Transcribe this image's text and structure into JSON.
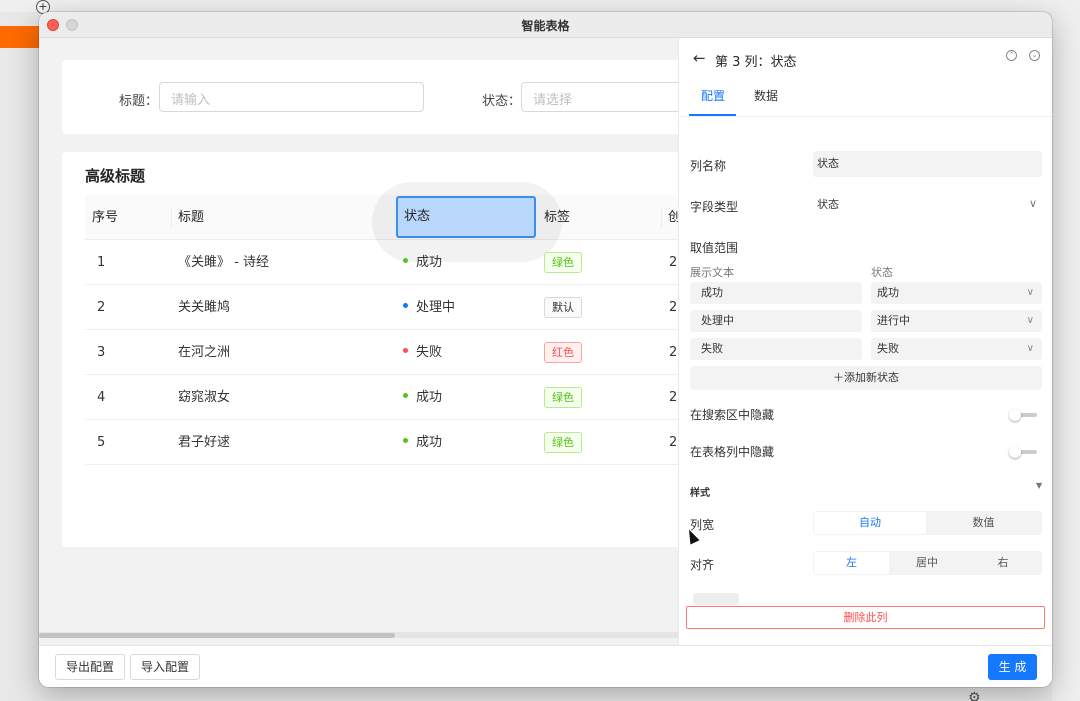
{
  "window": {
    "title": "智能表格"
  },
  "search_form": {
    "title_label": "标题：",
    "title_placeholder": "请输入",
    "status_label": "状态：",
    "status_placeholder": "请选择"
  },
  "table": {
    "title": "高级标题",
    "columns": [
      "序号",
      "标题",
      "状态",
      "标签",
      "创"
    ],
    "rows": [
      {
        "index": "1",
        "title": "《关雎》 - 诗经",
        "status": "成功",
        "status_color": "#52c41a",
        "tag": "绿色",
        "tag_type": "green",
        "extra": "2"
      },
      {
        "index": "2",
        "title": "关关雎鸠",
        "status": "处理中",
        "status_color": "#1677ff",
        "tag": "默认",
        "tag_type": "default",
        "extra": "2"
      },
      {
        "index": "3",
        "title": "在河之洲",
        "status": "失败",
        "status_color": "#ff4d4f",
        "tag": "红色",
        "tag_type": "red",
        "extra": "2"
      },
      {
        "index": "4",
        "title": "窈窕淑女",
        "status": "成功",
        "status_color": "#52c41a",
        "tag": "绿色",
        "tag_type": "green",
        "extra": "2"
      },
      {
        "index": "5",
        "title": "君子好逑",
        "status": "成功",
        "status_color": "#52c41a",
        "tag": "绿色",
        "tag_type": "green",
        "extra": "2"
      }
    ]
  },
  "footer": {
    "export_label": "导出配置",
    "import_label": "导入配置",
    "generate_label": "生 成"
  },
  "panel": {
    "title": "第 3 列：状态",
    "tabs": [
      "配置",
      "数据"
    ],
    "active_tab": "配置",
    "column_name_label": "列名称",
    "column_name_value": "状态",
    "field_type_label": "字段类型",
    "field_type_value": "状态",
    "range_label": "取值范围",
    "display_text_header": "展示文本",
    "status_header": "状态",
    "options": [
      {
        "text": "成功",
        "state": "成功"
      },
      {
        "text": "处理中",
        "state": "进行中"
      },
      {
        "text": "失败",
        "state": "失败"
      }
    ],
    "add_state_label": "＋添加新状态",
    "hide_in_search_label": "在搜索区中隐藏",
    "hide_in_table_label": "在表格列中隐藏",
    "style_label": "样式",
    "width_label": "列宽",
    "width_options": [
      "自动",
      "数值"
    ],
    "width_selected": "自动",
    "align_label": "对齐",
    "align_options": [
      "左",
      "居中",
      "右"
    ],
    "align_selected": "左",
    "delete_label": "删除此列"
  },
  "colors": {
    "primary": "#1677ff",
    "success": "#52c41a",
    "danger": "#ff4d4f",
    "selection_fill": "#b9d6fb"
  }
}
